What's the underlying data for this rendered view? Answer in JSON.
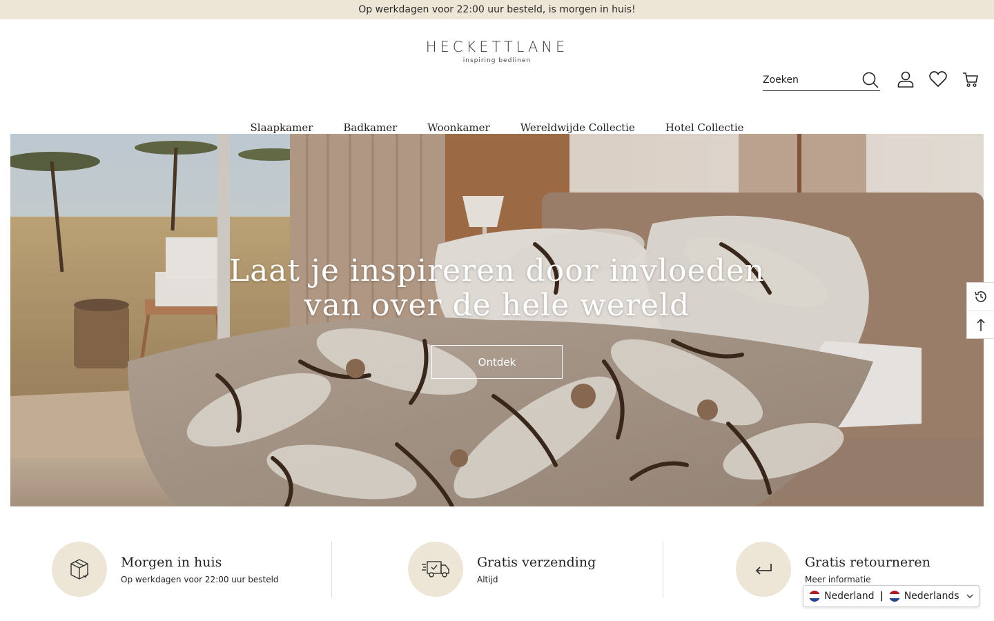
{
  "announcement": "Op werkdagen voor 22:00 uur besteld, is morgen in huis!",
  "logo": {
    "name": "HECKETTLANE",
    "tagline": "inspiring bedlinen"
  },
  "search": {
    "placeholder": "Zoeken"
  },
  "header_icons": [
    "search-icon",
    "account-icon",
    "heart-icon",
    "cart-icon"
  ],
  "nav": {
    "items": [
      "Slaapkamer",
      "Badkamer",
      "Woonkamer",
      "Wereldwijde Collectie",
      "Hotel Collectie"
    ]
  },
  "hero": {
    "title_line1": "Laat je inspireren door invloeden",
    "title_line2": "van over de hele wereld",
    "cta": "Ontdek"
  },
  "side_tools": [
    "recently-viewed-icon",
    "back-to-top-icon"
  ],
  "usps": [
    {
      "icon": "package-icon",
      "title": "Morgen in huis",
      "subtitle": "Op werkdagen voor 22:00 uur besteld"
    },
    {
      "icon": "truck-icon",
      "title": "Gratis verzending",
      "subtitle": "Altijd"
    },
    {
      "icon": "return-icon",
      "title": "Gratis retourneren",
      "subtitle": "Meer informatie"
    }
  ],
  "language_selector": {
    "country": "Nederland",
    "language": "Nederlands"
  },
  "colors": {
    "announcement_bg": "#ede5d6",
    "usp_circle": "#ede5d6",
    "text": "#222222"
  }
}
